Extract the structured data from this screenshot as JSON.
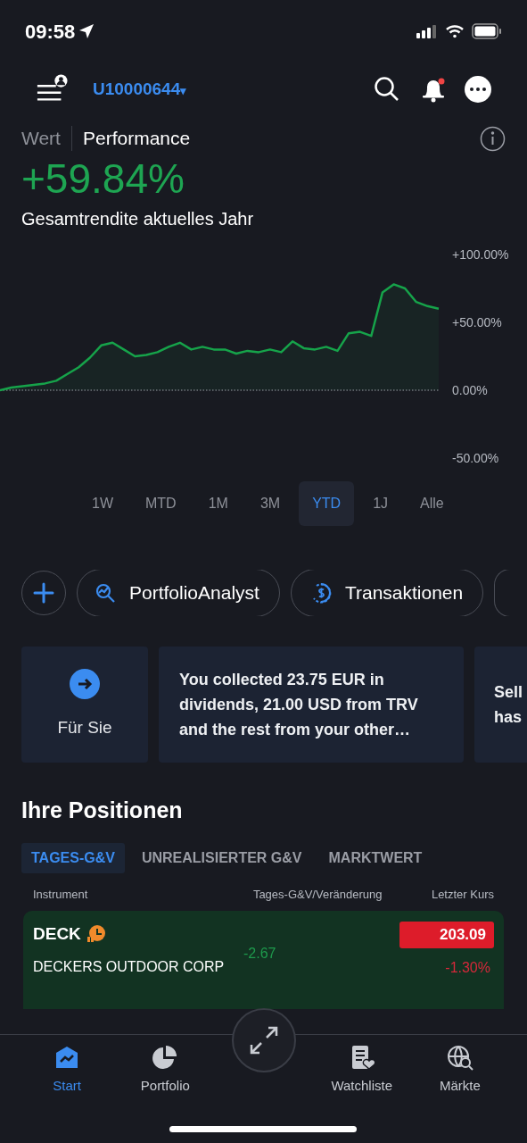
{
  "status_bar": {
    "time": "09:58"
  },
  "header": {
    "account": "U10000644",
    "caret": "▾",
    "notification_unread": true
  },
  "view_tabs": [
    {
      "label": "Wert",
      "selected": false
    },
    {
      "label": "Performance",
      "selected": true
    }
  ],
  "performance": {
    "value": "+59.84%",
    "caption": "Gesamtrendite aktuelles Jahr"
  },
  "chart_data": {
    "type": "area",
    "ylim": [
      -50,
      100
    ],
    "yticks": [
      {
        "value": 100,
        "label": "+100.00%"
      },
      {
        "value": 50,
        "label": "+50.00%"
      },
      {
        "value": 0,
        "label": "0.00%"
      },
      {
        "value": -50,
        "label": "-50.00%"
      }
    ],
    "series": [
      {
        "color": "#16a34a",
        "values": [
          0,
          2,
          3,
          4,
          5,
          7,
          12,
          17,
          24,
          33,
          35,
          30,
          25,
          26,
          28,
          32,
          35,
          30,
          32,
          30,
          30,
          27,
          29,
          28,
          30,
          28,
          36,
          31,
          30,
          32,
          29,
          42,
          43,
          40,
          72,
          78,
          75,
          65,
          62,
          60
        ]
      }
    ]
  },
  "periods": [
    {
      "label": "1W",
      "selected": false
    },
    {
      "label": "MTD",
      "selected": false
    },
    {
      "label": "1M",
      "selected": false
    },
    {
      "label": "3M",
      "selected": false
    },
    {
      "label": "YTD",
      "selected": true
    },
    {
      "label": "1J",
      "selected": false
    },
    {
      "label": "Alle",
      "selected": false
    }
  ],
  "actions": [
    {
      "kind": "add"
    },
    {
      "kind": "analyst",
      "label": "PortfolioAnalyst"
    },
    {
      "kind": "transactions",
      "label": "Transaktionen"
    },
    {
      "kind": "more"
    }
  ],
  "cards": [
    {
      "kind": "link",
      "label": "Für Sie"
    },
    {
      "kind": "message",
      "text": "You collected 23.75 EUR in dividends, 21.00 USD from TRV and the rest from your other…"
    },
    {
      "kind": "partial",
      "lines": [
        "Sell",
        "has"
      ]
    }
  ],
  "positions": {
    "title": "Ihre Positionen",
    "tabs": [
      {
        "label": "TAGES-G&V",
        "selected": true
      },
      {
        "label": "UNREALISIERTER G&V",
        "selected": false
      },
      {
        "label": "MARKTWERT",
        "selected": false
      }
    ],
    "columns": [
      "Instrument",
      "Tages-G&V/Veränderung",
      "Letzter Kurs"
    ],
    "rows": [
      {
        "symbol": "DECK",
        "name": "DECKERS OUTDOOR CORP",
        "pnl": "-2.67",
        "price": "203.09",
        "change": "-1.30%",
        "market_closed": true
      }
    ]
  },
  "nav": [
    {
      "kind": "start",
      "label": "Start",
      "selected": true
    },
    {
      "kind": "portfolio",
      "label": "Portfolio",
      "selected": false
    },
    {
      "kind": "trade",
      "selected": false
    },
    {
      "kind": "watchlist",
      "label": "Watchliste",
      "selected": false
    },
    {
      "kind": "markets",
      "label": "Märkte",
      "selected": false
    }
  ]
}
